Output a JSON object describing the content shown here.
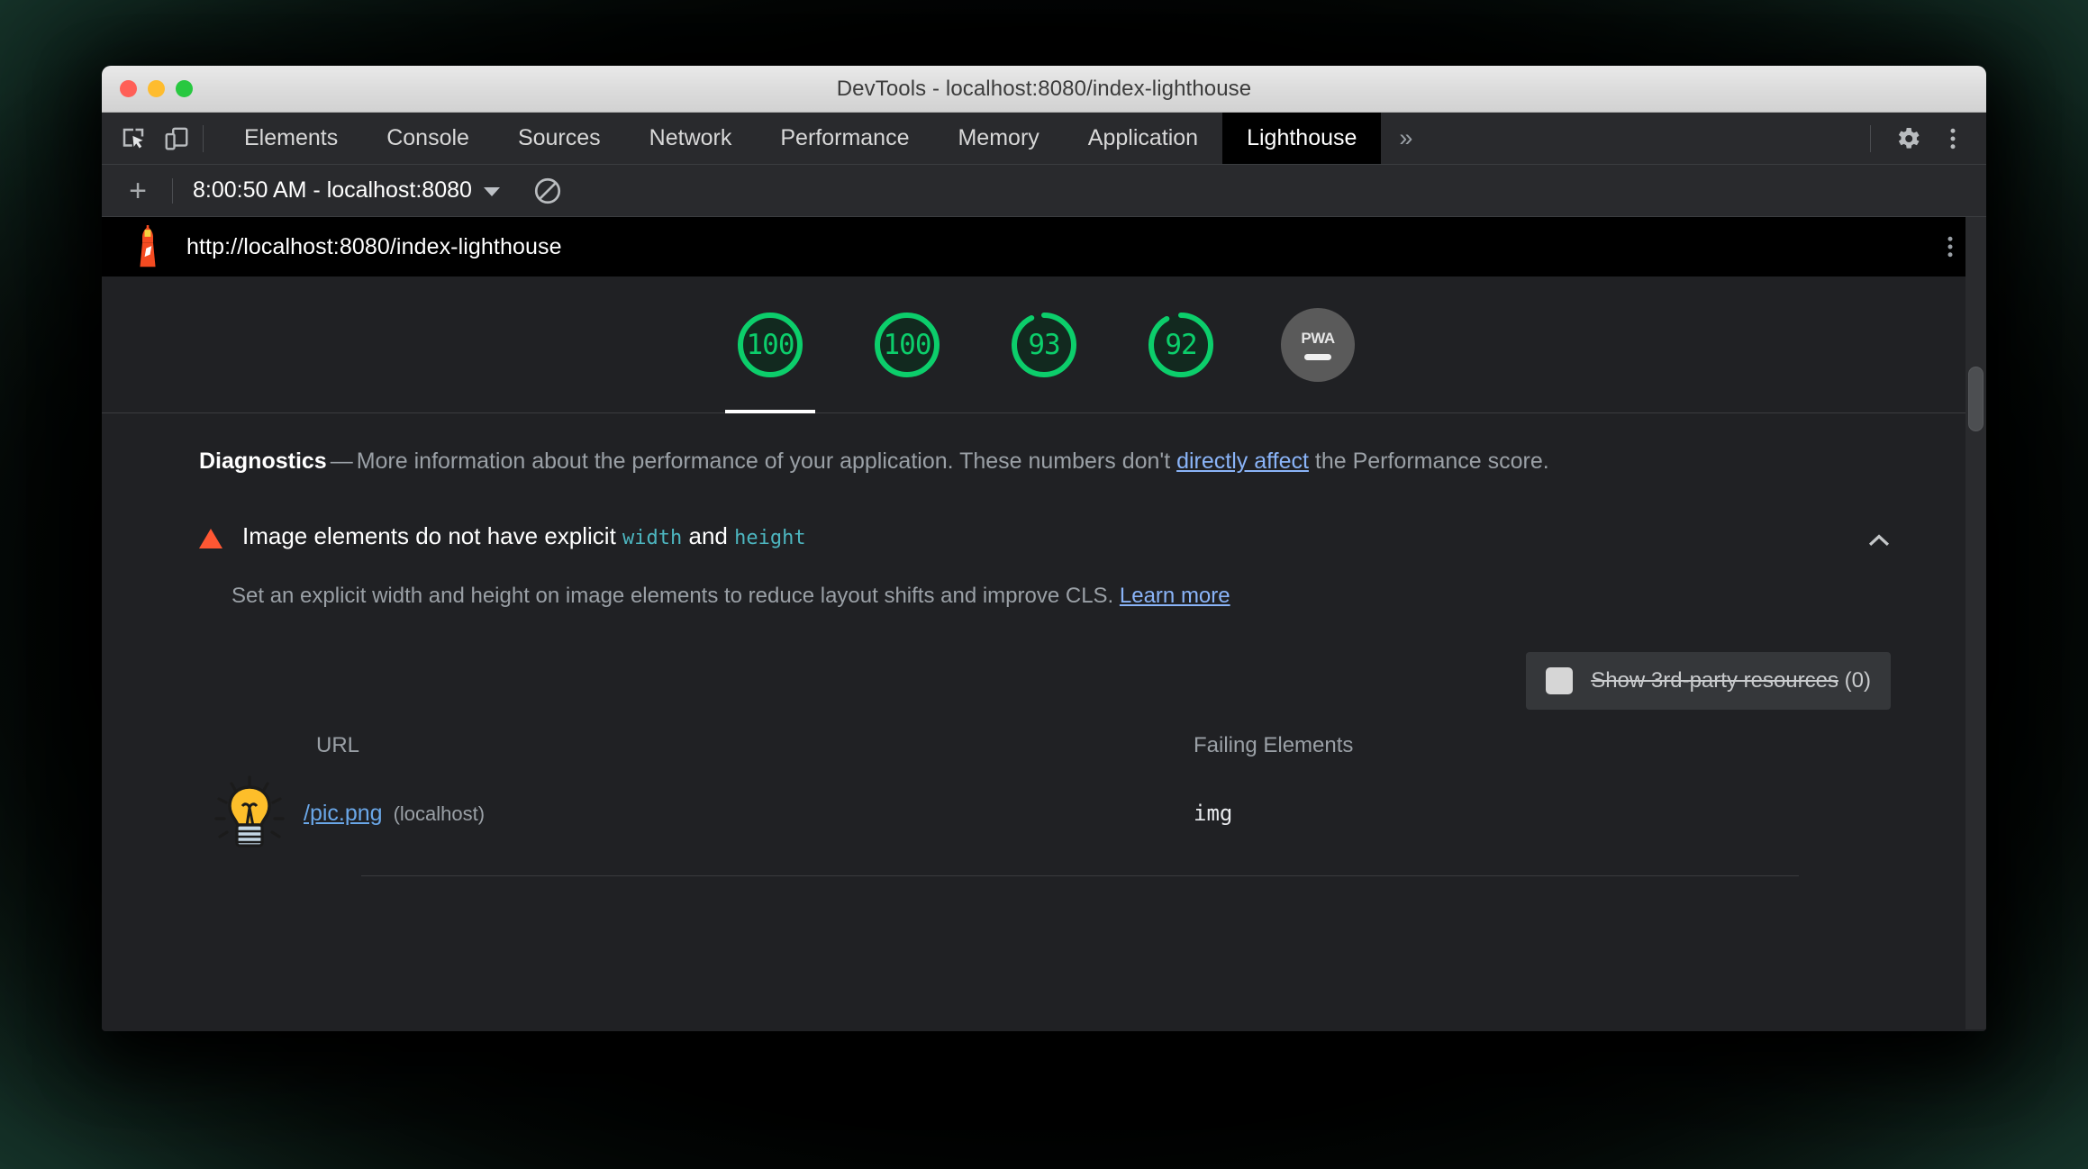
{
  "window": {
    "title": "DevTools - localhost:8080/index-lighthouse",
    "traffic": {
      "close": "close-window",
      "minimize": "minimize-window",
      "maximize": "maximize-window"
    }
  },
  "devtools": {
    "tools": {
      "inspect_icon": "inspect-element-icon",
      "device_toolbar_icon": "device-toolbar-icon"
    },
    "tabs": [
      {
        "label": "Elements",
        "selected": false
      },
      {
        "label": "Console",
        "selected": false
      },
      {
        "label": "Sources",
        "selected": false
      },
      {
        "label": "Network",
        "selected": false
      },
      {
        "label": "Performance",
        "selected": false
      },
      {
        "label": "Memory",
        "selected": false
      },
      {
        "label": "Application",
        "selected": false
      },
      {
        "label": "Lighthouse",
        "selected": true
      }
    ],
    "more_tabs_label": "»",
    "settings_icon": "gear-icon",
    "main_menu_icon": "kebab-menu-icon"
  },
  "lighthouse_toolbar": {
    "add_label": "+",
    "report_selector": "8:00:50 AM - localhost:8080",
    "dropdown_icon": "chevron-down-icon",
    "clear_icon": "clear-all-icon"
  },
  "report": {
    "logo_icon": "lighthouse-logo-icon",
    "url": "http://localhost:8080/index-lighthouse",
    "kebab_icon": "kebab-menu-icon",
    "gauges": [
      {
        "score": "100",
        "selected": true
      },
      {
        "score": "100",
        "selected": false
      },
      {
        "score": "93",
        "selected": false
      },
      {
        "score": "92",
        "selected": false
      }
    ],
    "pwa": {
      "label": "PWA",
      "state": "dash"
    },
    "colors": {
      "score_pass": "#0cce6b",
      "link": "#8ab4f8",
      "warning": "#ff5733",
      "code": "#4db6c0"
    }
  },
  "diagnostics": {
    "heading": "Diagnostics",
    "dash": "—",
    "description_before_link": "More information about the performance of your application. These numbers don't ",
    "link_text": "directly affect",
    "description_after_link": " the Performance score."
  },
  "audit": {
    "title_part1": "Image elements do not have explicit ",
    "code_width": "width",
    "title_and": " and ",
    "code_height": "height",
    "collapse_icon": "chevron-up-icon",
    "description": "Set an explicit width and height on image elements to reduce layout shifts and improve CLS.",
    "learn_more": "Learn more",
    "third_party": {
      "checkbox_state": "unchecked",
      "label_struck": "Show 3rd-party resources",
      "count": "(0)"
    },
    "table": {
      "columns": [
        "URL",
        "Failing Elements"
      ],
      "rows": [
        {
          "thumbnail_icon": "lightbulb-thumbnail-icon",
          "url": "/pic.png",
          "host": "(localhost)",
          "failing_element": "img"
        }
      ]
    }
  }
}
